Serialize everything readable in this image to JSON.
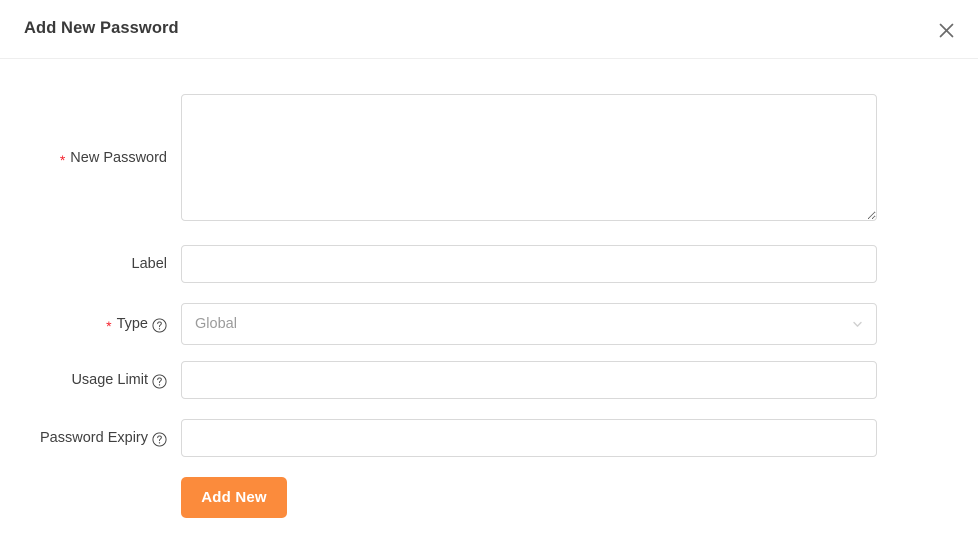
{
  "header": {
    "title": "Add New Password",
    "close_icon": "close-icon"
  },
  "form": {
    "fields": [
      {
        "label": "New Password",
        "required": true,
        "has_help": false,
        "control": "textarea",
        "value": "",
        "placeholder": ""
      },
      {
        "label": "Label",
        "required": false,
        "has_help": false,
        "control": "input",
        "value": "",
        "placeholder": ""
      },
      {
        "label": "Type",
        "required": true,
        "has_help": true,
        "control": "select",
        "value": "Global",
        "placeholder": "Global"
      },
      {
        "label": "Usage Limit",
        "required": false,
        "has_help": true,
        "control": "input",
        "value": "",
        "placeholder": ""
      },
      {
        "label": "Password Expiry",
        "required": false,
        "has_help": true,
        "control": "input",
        "value": "",
        "placeholder": ""
      }
    ],
    "submit_label": "Add New"
  },
  "icons": {
    "help": "question-circle-icon",
    "chevron_down": "chevron-down-icon",
    "close": "close-icon",
    "required_star": "*"
  },
  "colors": {
    "accent": "#fb8b3c",
    "required": "#f5222d",
    "border": "#d9d9d9",
    "text": "#404040",
    "placeholder": "#9b9b9b"
  }
}
